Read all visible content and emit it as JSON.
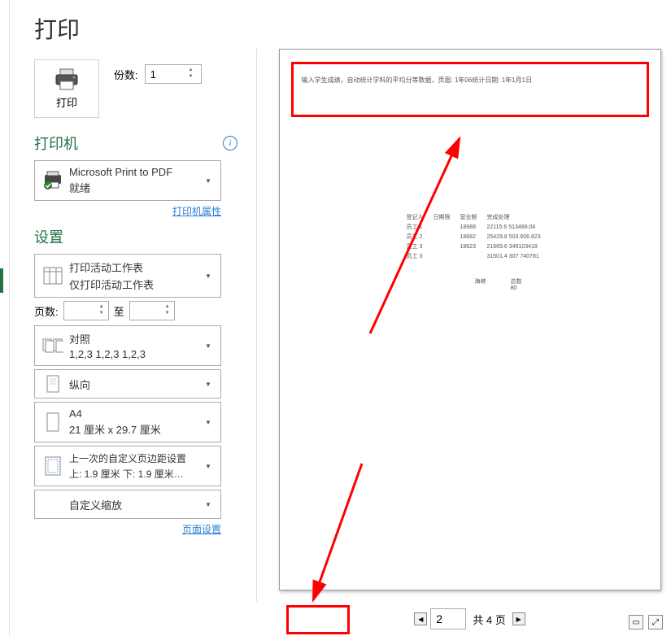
{
  "title": "打印",
  "print_button_label": "打印",
  "copies_label": "份数:",
  "copies_value": "1",
  "printer_section": "打印机",
  "printer": {
    "name": "Microsoft Print to PDF",
    "status": "就绪"
  },
  "printer_properties_link": "打印机属性",
  "settings_section": "设置",
  "settings": {
    "print_area": {
      "main": "打印活动工作表",
      "sub": "仅打印活动工作表"
    },
    "pages_label": "页数:",
    "pages_to": "至",
    "collate": {
      "main": "对照",
      "sub": "1,2,3    1,2,3    1,2,3"
    },
    "orientation": {
      "main": "纵向"
    },
    "paper": {
      "main": "A4",
      "sub": "21 厘米 x 29.7 厘米"
    },
    "margins": {
      "main": "上一次的自定义页边距设置",
      "sub": "上: 1.9 厘米 下: 1.9 厘米…"
    },
    "scaling": {
      "main": "自定义缩放"
    }
  },
  "page_setup_link": "页面设置",
  "preview": {
    "header_text": "输入学生成绩，自动统计学科的平均分等数据，页眉: 1年06统计日期: 1年1月1日",
    "table": {
      "headers": [
        "登记人",
        "日期限",
        "营业额",
        "完成处理"
      ],
      "rows": [
        [
          "员工 1",
          "",
          "18688",
          "22115.6 513488.04"
        ],
        [
          "员工 2",
          "",
          "18682",
          "25429.8 503.606.823"
        ],
        [
          "员工 3",
          "",
          "18623",
          "21669.6 349103418"
        ],
        [
          "员工 3",
          "",
          "",
          "31501.4 307 740781"
        ]
      ]
    },
    "footer": {
      "left": "海峡",
      "right": "总数\n80"
    }
  },
  "nav": {
    "current_page": "2",
    "total_label": "共 4 页"
  }
}
